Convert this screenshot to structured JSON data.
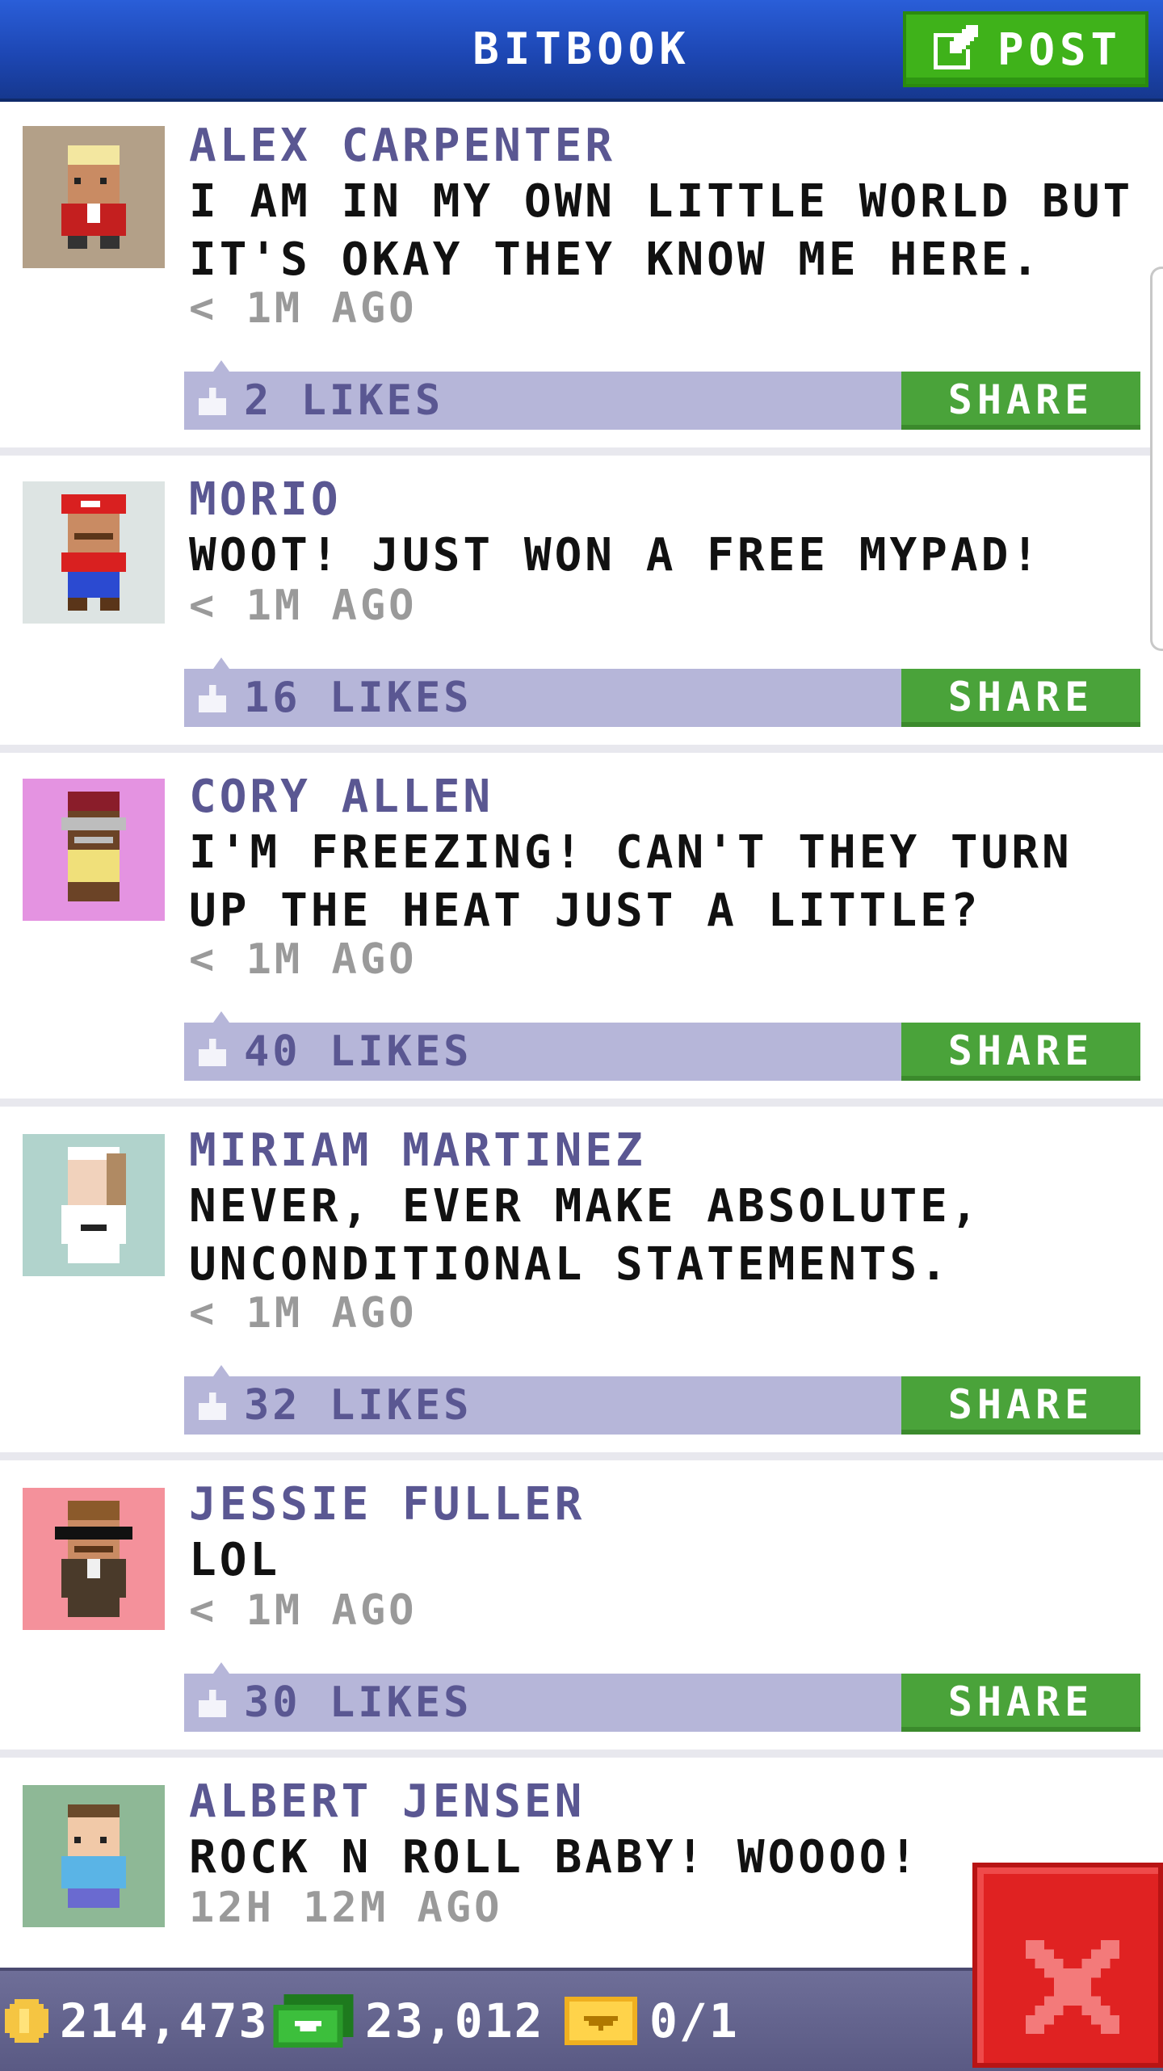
{
  "header": {
    "title": "BITBOOK",
    "post_label": "POST"
  },
  "posts": [
    {
      "author": "ALEX CARPENTER",
      "message": "I AM IN MY OWN LITTLE WORLD BUT IT'S OKAY THEY KNOW ME HERE.",
      "time": "< 1M AGO",
      "likes": "2 LIKES",
      "share_label": "SHARE",
      "avatar_bg": "#b3a088"
    },
    {
      "author": "MORIO",
      "message": "WOOT! JUST WON A FREE MYPAD!",
      "time": "< 1M AGO",
      "likes": "16 LIKES",
      "share_label": "SHARE",
      "avatar_bg": "#dde4e3"
    },
    {
      "author": "CORY ALLEN",
      "message": "I'M FREEZING! CAN'T THEY TURN UP THE HEAT JUST A LITTLE?",
      "time": "< 1M AGO",
      "likes": "40 LIKES",
      "share_label": "SHARE",
      "avatar_bg": "#e493e1"
    },
    {
      "author": "MIRIAM MARTINEZ",
      "message": "NEVER, EVER MAKE ABSOLUTE, UNCONDITIONAL STATEMENTS.",
      "time": "< 1M AGO",
      "likes": "32 LIKES",
      "share_label": "SHARE",
      "avatar_bg": "#b1d3cc"
    },
    {
      "author": "JESSIE FULLER",
      "message": "LOL",
      "time": "< 1M AGO",
      "likes": "30 LIKES",
      "share_label": "SHARE",
      "avatar_bg": "#f4919b"
    },
    {
      "author": "ALBERT JENSEN",
      "message": "ROCK N ROLL BABY! WOOOO!",
      "time": "12H 12M AGO",
      "avatar_bg": "#8eb896"
    }
  ],
  "status_bar": {
    "coins": "214,473",
    "bux": "23,012",
    "tickets": "0/1"
  },
  "colors": {
    "header_blue": "#1d47b4",
    "post_green": "#3fb21a",
    "share_green": "#4aa33a",
    "likes_bar": "#b6b6d9",
    "name_purple": "#5a5792",
    "close_red": "#e02222"
  },
  "icons": {
    "post": "compose-icon",
    "like": "thumbs-up-icon",
    "coin": "coin-icon",
    "bux": "bux-icon",
    "ticket": "ticket-icon",
    "close": "close-icon"
  }
}
